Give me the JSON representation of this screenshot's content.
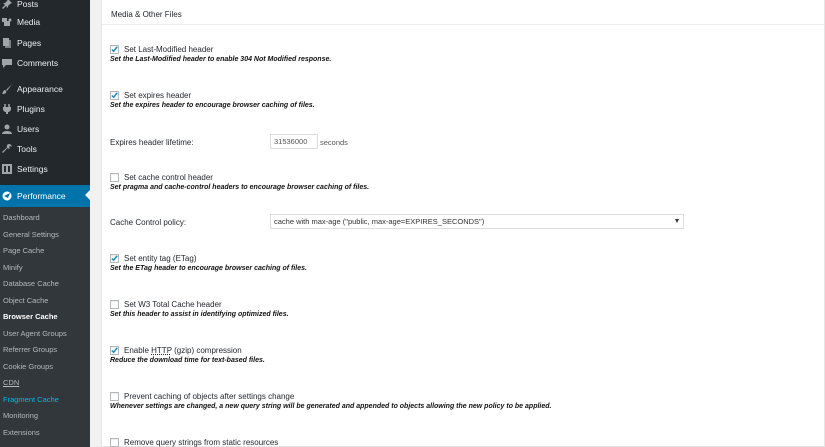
{
  "sidebar": {
    "menu": [
      {
        "label": "Posts",
        "icon": "pin-icon"
      },
      {
        "label": "Media",
        "icon": "media-icon"
      },
      {
        "label": "Pages",
        "icon": "pages-icon"
      },
      {
        "label": "Comments",
        "icon": "comments-icon"
      },
      {
        "label": "Appearance",
        "icon": "brush-icon"
      },
      {
        "label": "Plugins",
        "icon": "plugins-icon"
      },
      {
        "label": "Users",
        "icon": "users-icon"
      },
      {
        "label": "Tools",
        "icon": "wrench-icon"
      },
      {
        "label": "Settings",
        "icon": "settings-icon"
      },
      {
        "label": "Performance",
        "icon": "performance-icon"
      }
    ],
    "submenu": [
      "Dashboard",
      "General Settings",
      "Page Cache",
      "Minify",
      "Database Cache",
      "Object Cache",
      "Browser Cache",
      "User Agent Groups",
      "Referrer Groups",
      "Cookie Groups",
      "CDN",
      "Fragment Cache",
      "Monitoring",
      "Extensions"
    ]
  },
  "panel": {
    "title": "Media & Other Files",
    "last_modified": {
      "label": "Set Last-Modified header",
      "checked": true,
      "desc": "Set the Last-Modified header to enable 304 Not Modified response."
    },
    "expires": {
      "label": "Set expires header",
      "checked": true,
      "desc": "Set the expires header to encourage browser caching of files."
    },
    "lifetime": {
      "label": "Expires header lifetime:",
      "value": "31536000",
      "unit": "seconds"
    },
    "cache_control": {
      "label": "Set cache control header",
      "checked": false,
      "desc": "Set pragma and cache-control headers to encourage browser caching of files."
    },
    "policy": {
      "label": "Cache Control policy:",
      "value": "cache with max-age (\"public, max-age=EXPIRES_SECONDS\")"
    },
    "etag": {
      "label": "Set entity tag (ETag)",
      "checked": true,
      "desc_pre": "Set the ",
      "desc_em": "ETag",
      "desc_post": " header to encourage browser caching of files."
    },
    "w3tc_header": {
      "label": "Set W3 Total Cache header",
      "checked": false,
      "desc": "Set this header to assist in identifying optimized files."
    },
    "gzip": {
      "label_pre": "Enable ",
      "label_abbr": "HTTP",
      "label_post": " (gzip) compression",
      "checked": true,
      "desc": "Reduce the download time for text-based files."
    },
    "prevent_caching": {
      "label": "Prevent caching of objects after settings change",
      "checked": false,
      "desc": "Whenever settings are changed, a new query string will be generated and appended to objects allowing the new policy to be applied."
    },
    "remove_query": {
      "label": "Remove query strings from static resources",
      "checked": false
    }
  },
  "colors": {
    "sidebar_bg": "#23282d",
    "submenu_bg": "#32373c",
    "active_bg": "#0073aa",
    "accent_teal": "#00b9eb",
    "checkmark": "#1e8cbe"
  }
}
